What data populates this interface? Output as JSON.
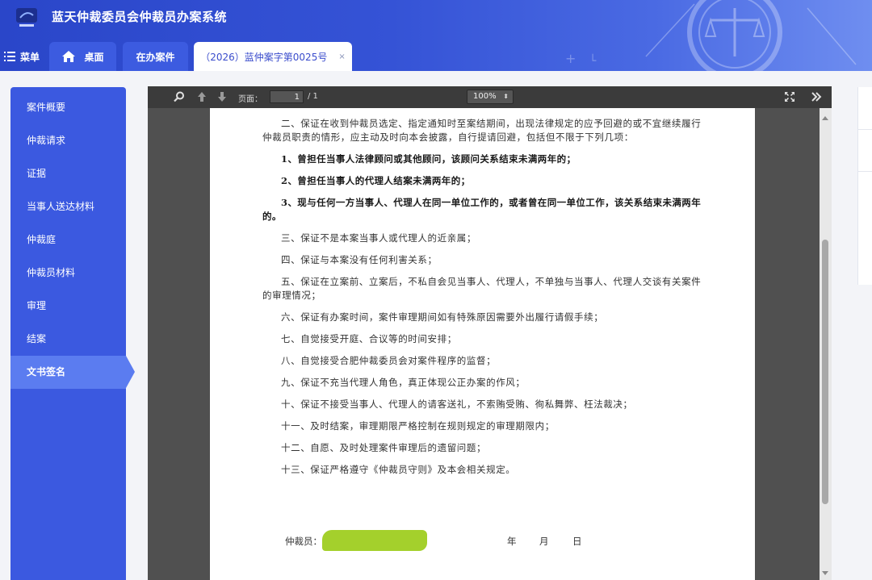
{
  "header": {
    "title": "蓝天仲裁委员会仲裁员办案系统"
  },
  "nav": {
    "menu_label": "菜单",
    "tabs": [
      {
        "label": "桌面",
        "icon": "home-icon"
      },
      {
        "label": "在办案件"
      },
      {
        "label": "（2026）蓝仲案字第0025号",
        "active": true,
        "close": "×"
      }
    ]
  },
  "sidebar": {
    "items": [
      {
        "label": "案件概要"
      },
      {
        "label": "仲裁请求"
      },
      {
        "label": "证据"
      },
      {
        "label": "当事人送达材料"
      },
      {
        "label": "仲裁庭"
      },
      {
        "label": "仲裁员材料"
      },
      {
        "label": "审理"
      },
      {
        "label": "结案"
      },
      {
        "label": "文书签名",
        "active": true
      }
    ]
  },
  "viewer": {
    "page_label": "页面：",
    "page_value": "1",
    "page_total": "/ 1",
    "zoom": "100%",
    "icons": [
      "search-icon",
      "previous-page-icon",
      "next-page-icon",
      "fullscreen-icon",
      "more-tools-icon"
    ]
  },
  "document": {
    "paragraphs": [
      {
        "text": "二、保证在收到仲裁员选定、指定通知时至案结期间，出现法律规定的应予回避的或不宜继续履行仲裁员职责的情形，应主动及时向本会披露，自行提请回避，包括但不限于下列几项：",
        "bold": false
      },
      {
        "text": "1、曾担任当事人法律顾问或其他顾问，该顾问关系结束未满两年的；",
        "bold": true
      },
      {
        "text": "2、曾担任当事人的代理人结案未满两年的；",
        "bold": true
      },
      {
        "text": "3、现与任何一方当事人、代理人在同一单位工作的，或者曾在同一单位工作，该关系结束未满两年的。",
        "bold": true
      },
      {
        "text": "三、保证不是本案当事人或代理人的近亲属；",
        "bold": false
      },
      {
        "text": "四、保证与本案没有任何利害关系；",
        "bold": false
      },
      {
        "text": "五、保证在立案前、立案后，不私自会见当事人、代理人，不单独与当事人、代理人交谈有关案件的审理情况；",
        "bold": false
      },
      {
        "text": "六、保证有办案时间，案件审理期间如有特殊原因需要外出履行请假手续；",
        "bold": false
      },
      {
        "text": "七、自觉接受开庭、合议等的时间安排；",
        "bold": false
      },
      {
        "text": "八、自觉接受合肥仲裁委员会对案件程序的监督；",
        "bold": false
      },
      {
        "text": "九、保证不充当代理人角色，真正体现公正办案的作风；",
        "bold": false
      },
      {
        "text": "十、保证不接受当事人、代理人的请客送礼，不索贿受贿、徇私舞弊、枉法裁决；",
        "bold": false
      },
      {
        "text": "十一、及时结案，审理期限严格控制在规则规定的审理期限内；",
        "bold": false
      },
      {
        "text": "十二、自愿、及时处理案件审理后的遗留问题；",
        "bold": false
      },
      {
        "text": "十三、保证严格遵守《仲裁员守则》及本会相关规定。",
        "bold": false
      }
    ],
    "signature": {
      "label": "仲裁员：",
      "year": "年",
      "month": "月",
      "day": "日"
    }
  },
  "colors": {
    "header_blue": "#2a46c9",
    "sidebar_blue": "#3b59e0",
    "sidebar_active": "#5b7cf0",
    "viewer_bg": "#505050",
    "redaction_green": "#9ccc1a"
  }
}
